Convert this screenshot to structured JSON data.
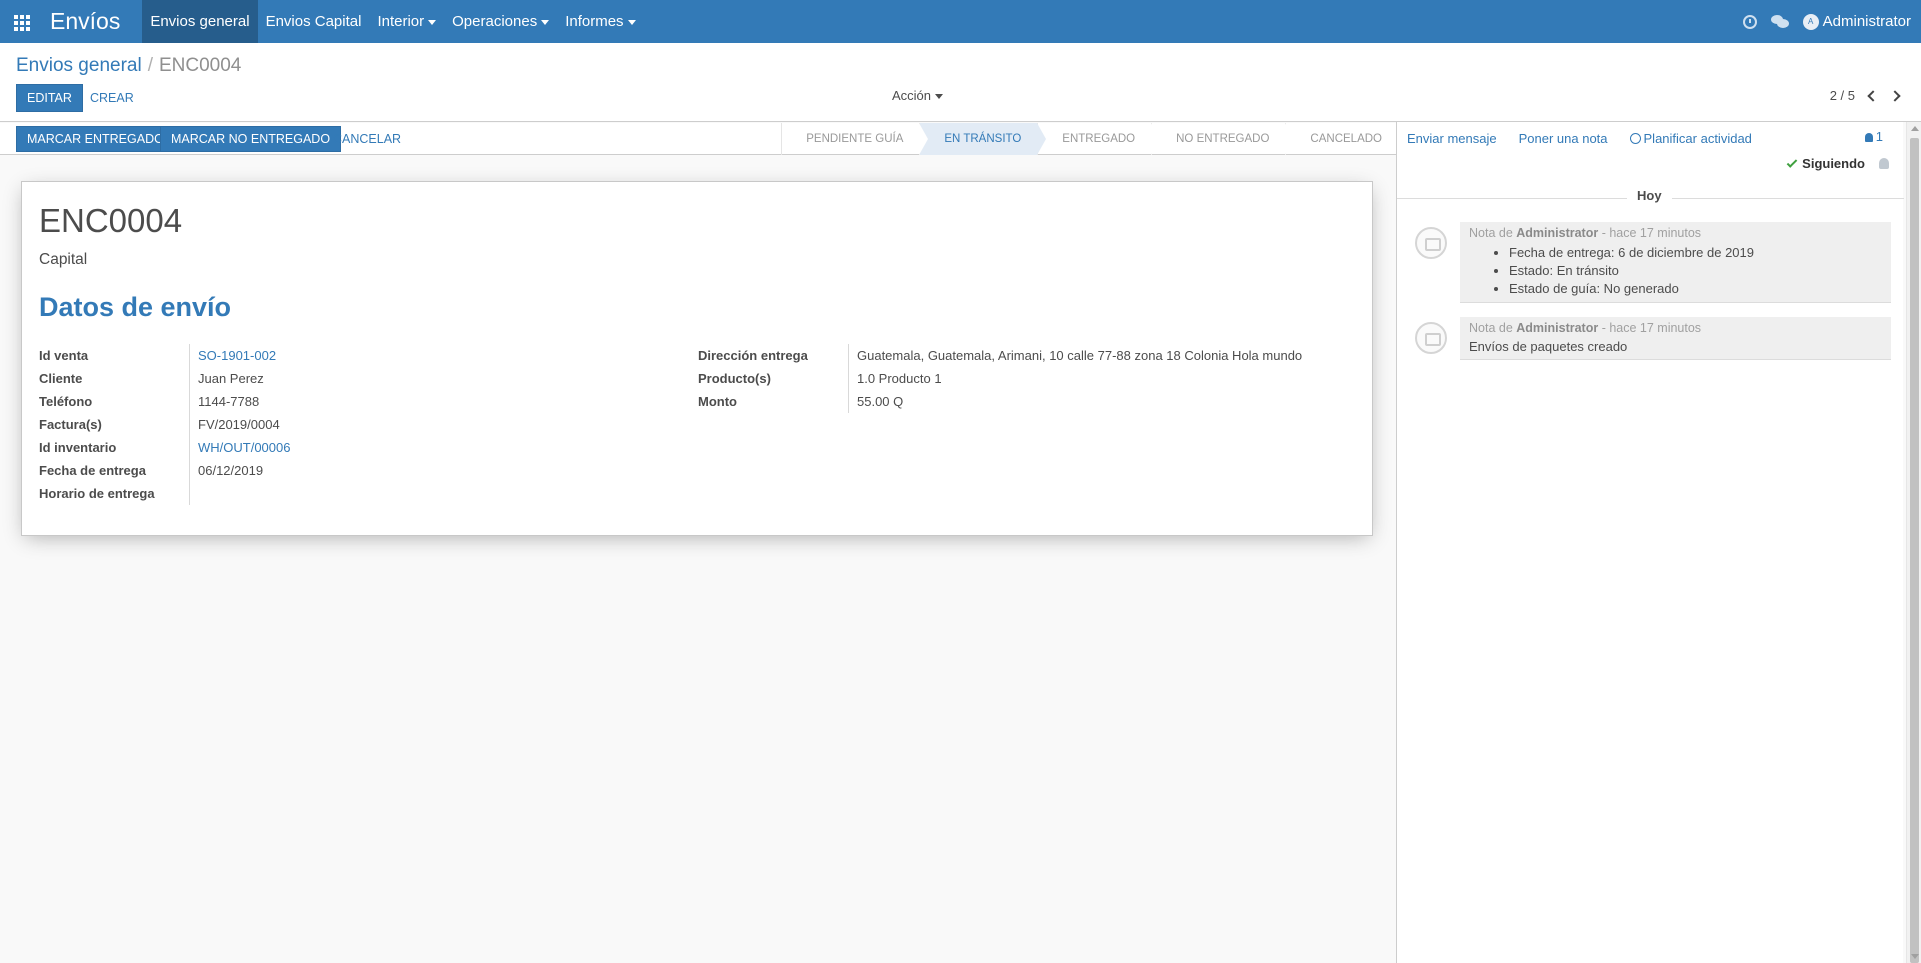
{
  "navbar": {
    "app_title": "Envíos",
    "menu": [
      {
        "label": "Envios general"
      },
      {
        "label": "Envios Capital"
      },
      {
        "label": "Interior"
      },
      {
        "label": "Operaciones"
      },
      {
        "label": "Informes"
      }
    ],
    "user_name": "Administrator",
    "user_initial": "A"
  },
  "breadcrumb": {
    "parent": "Envios general",
    "separator": "/",
    "current": "ENC0004"
  },
  "control": {
    "edit_label": "EDITAR",
    "create_label": "CREAR",
    "action_label": "Acción",
    "pager": "2 / 5"
  },
  "statusbar": {
    "buttons": {
      "mark_delivered": "MARCAR ENTREGADO",
      "mark_not_delivered": "MARCAR NO ENTREGADO",
      "cancel": "CANCELAR"
    },
    "steps": [
      {
        "label": "PENDIENTE GUÍA"
      },
      {
        "label": "EN TRÁNSITO"
      },
      {
        "label": "ENTREGADO"
      },
      {
        "label": "NO ENTREGADO"
      },
      {
        "label": "CANCELADO"
      }
    ],
    "active_step": "EN TRÁNSITO"
  },
  "form": {
    "name": "ENC0004",
    "subtitle": "Capital",
    "section_title": "Datos de envío",
    "left_fields": [
      {
        "label": "Id venta",
        "value": "SO-1901-002"
      },
      {
        "label": "Cliente",
        "value": "Juan Perez"
      },
      {
        "label": "Teléfono",
        "value": "1144-7788"
      },
      {
        "label": "Factura(s)",
        "value": "FV/2019/0004"
      },
      {
        "label": "Id inventario",
        "value": "WH/OUT/00006"
      },
      {
        "label": "Fecha de entrega",
        "value": "06/12/2019"
      },
      {
        "label": "Horario de entrega",
        "value": ""
      }
    ],
    "right_fields": [
      {
        "label": "Dirección entrega",
        "value": "Guatemala, Guatemala, Arimani, 10 calle 77-88 zona 18 Colonia Hola mundo"
      },
      {
        "label": "Producto(s)",
        "value": "1.0 Producto 1"
      },
      {
        "label": "Monto",
        "value": "55.00 Q"
      }
    ]
  },
  "chatter": {
    "send_message": "Enviar mensaje",
    "log_note": "Poner una nota",
    "schedule_activity": "Planificar actividad",
    "followers_count": "1",
    "following_label": "Siguiendo",
    "today_label": "Hoy",
    "messages": [
      {
        "prefix": "Nota de",
        "author": "Administrator",
        "time": "- hace 17 minutos",
        "items": [
          "Fecha de entrega: 6 de diciembre de 2019",
          "Estado: En tránsito",
          "Estado de guía: No generado"
        ]
      },
      {
        "prefix": "Nota de",
        "author": "Administrator",
        "time": "- hace 17 minutos",
        "body": "Envíos de paquetes creado"
      }
    ]
  }
}
